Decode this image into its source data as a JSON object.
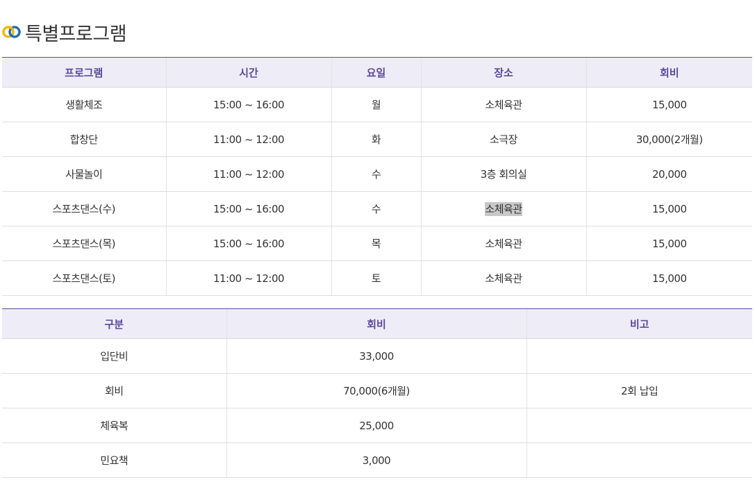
{
  "page": {
    "title": "특별프로그램",
    "accent_color": "#5b4a9a",
    "header_bg": "#eeedf7",
    "icon": "rings-logo-icon"
  },
  "program_table": {
    "headers": [
      "프로그램",
      "시간",
      "요일",
      "장소",
      "회비"
    ],
    "rows": [
      {
        "program": "생활체조",
        "time": "15:00 ~ 16:00",
        "day": "월",
        "place": "소체육관",
        "fee": "15,000"
      },
      {
        "program": "합창단",
        "time": "11:00 ~ 12:00",
        "day": "화",
        "place": "소극장",
        "fee": "30,000(2개월)"
      },
      {
        "program": "사물놀이",
        "time": "11:00 ~ 12:00",
        "day": "수",
        "place": "3층 회의실",
        "fee": "20,000"
      },
      {
        "program": "스포츠댄스(수)",
        "time": "15:00 ~ 16:00",
        "day": "수",
        "place": "소체육관",
        "fee": "15,000"
      },
      {
        "program": "스포츠댄스(목)",
        "time": "15:00 ~ 16:00",
        "day": "목",
        "place": "소체육관",
        "fee": "15,000"
      },
      {
        "program": "스포츠댄스(토)",
        "time": "11:00 ~ 12:00",
        "day": "토",
        "place": "소체육관",
        "fee": "15,000"
      }
    ]
  },
  "fee_table": {
    "headers": [
      "구분",
      "회비",
      "비고"
    ],
    "rows": [
      {
        "category": "입단비",
        "fee": "33,000",
        "note": ""
      },
      {
        "category": "회비",
        "fee": "70,000(6개월)",
        "note": "2회 납입"
      },
      {
        "category": "체육복",
        "fee": "25,000",
        "note": ""
      },
      {
        "category": "민요책",
        "fee": "3,000",
        "note": ""
      }
    ]
  }
}
